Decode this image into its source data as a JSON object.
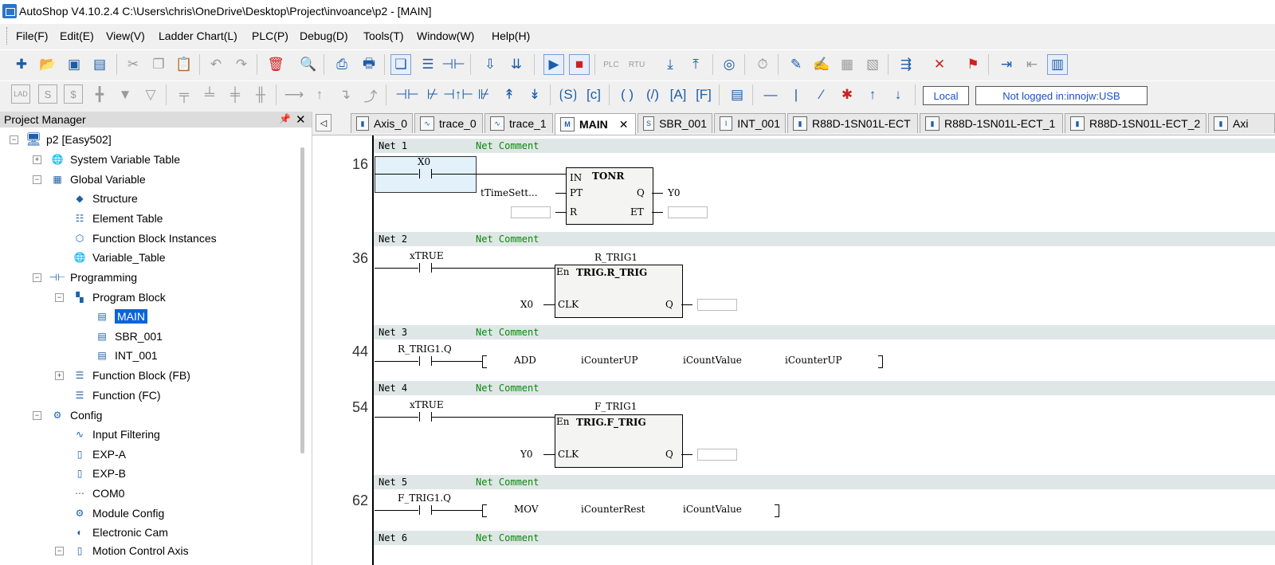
{
  "title_bar": {
    "title": "AutoShop V4.10.2.4  C:\\Users\\chris\\OneDrive\\Desktop\\Project\\invoance\\p2 - [MAIN]"
  },
  "menu": [
    "File(F)",
    "Edit(E)",
    "View(V)",
    "Ladder Chart(L)",
    "PLC(P)",
    "Debug(D)",
    "Tools(T)",
    "Window(W)",
    "Help(H)"
  ],
  "status": {
    "local": "Local",
    "login": "Not logged in:innojw:USB"
  },
  "project_manager": {
    "title": "Project Manager",
    "pin": "📌",
    "close": "✕",
    "tree": [
      {
        "label": "p2 [Easy502]",
        "icon": "computer-icon"
      },
      {
        "label": "System Variable Table",
        "icon": "globe-icon"
      },
      {
        "label": "Global Variable",
        "icon": "table-icon"
      },
      {
        "label": "Structure",
        "icon": "structure-icon"
      },
      {
        "label": "Element Table",
        "icon": "element-table-icon"
      },
      {
        "label": "Function Block Instances",
        "icon": "cube-icon"
      },
      {
        "label": "Variable_Table",
        "icon": "globe-icon"
      },
      {
        "label": "Programming",
        "icon": "ladder-icon"
      },
      {
        "label": "Program Block",
        "icon": "blocks-icon"
      },
      {
        "label": "MAIN",
        "icon": "main-program-icon"
      },
      {
        "label": "SBR_001",
        "icon": "subroutine-icon"
      },
      {
        "label": "INT_001",
        "icon": "interrupt-icon"
      },
      {
        "label": "Function Block (FB)",
        "icon": "fb-icon"
      },
      {
        "label": "Function (FC)",
        "icon": "fc-icon"
      },
      {
        "label": "Config",
        "icon": "config-icon"
      },
      {
        "label": "Input Filtering",
        "icon": "filter-icon"
      },
      {
        "label": "EXP-A",
        "icon": "exp-icon"
      },
      {
        "label": "EXP-B",
        "icon": "exp-icon"
      },
      {
        "label": "COM0",
        "icon": "com-port-icon"
      },
      {
        "label": "Module Config",
        "icon": "module-icon"
      },
      {
        "label": "Electronic Cam",
        "icon": "cam-icon"
      },
      {
        "label": "Motion Control Axis",
        "icon": "axis-icon"
      }
    ]
  },
  "tabs": [
    {
      "label": "Axis_0"
    },
    {
      "label": "trace_0"
    },
    {
      "label": "trace_1"
    },
    {
      "label": "MAIN",
      "close": "✕"
    },
    {
      "label": "SBR_001"
    },
    {
      "label": "INT_001"
    },
    {
      "label": "R88D-1SN01L-ECT"
    },
    {
      "label": "R88D-1SN01L-ECT_1"
    },
    {
      "label": "R88D-1SN01L-ECT_2"
    },
    {
      "label": "Axi"
    }
  ],
  "tab_scroll_left": "◁",
  "ladder": {
    "net_comment_label": "Net Comment",
    "nets": [
      {
        "label": "Net 1",
        "line": "16",
        "contact": "X0",
        "fb_name": "TONR",
        "pin_in": "IN",
        "pin_pt": "PT",
        "pin_r": "R",
        "pin_q": "Q",
        "pin_et": "ET",
        "pt_var": "tTimeSett...",
        "q_out": "Y0"
      },
      {
        "label": "Net 2",
        "line": "36",
        "contact": "xTRUE",
        "instance": "R_TRIG1",
        "fb_name": "TRIG.R_TRIG",
        "pin_en": "En",
        "pin_clk": "CLK",
        "pin_q": "Q",
        "clk_var": "X0"
      },
      {
        "label": "Net 3",
        "line": "44",
        "contact": "R_TRIG1.Q",
        "op": "ADD",
        "args": [
          "iCounterUP",
          "iCountValue",
          "iCounterUP"
        ]
      },
      {
        "label": "Net 4",
        "line": "54",
        "contact": "xTRUE",
        "instance": "F_TRIG1",
        "fb_name": "TRIG.F_TRIG",
        "pin_en": "En",
        "pin_clk": "CLK",
        "pin_q": "Q",
        "clk_var": "Y0"
      },
      {
        "label": "Net 5",
        "line": "62",
        "contact": "F_TRIG1.Q",
        "op": "MOV",
        "args": [
          "iCounterRest",
          "iCountValue"
        ]
      },
      {
        "label": "Net 6"
      }
    ]
  }
}
